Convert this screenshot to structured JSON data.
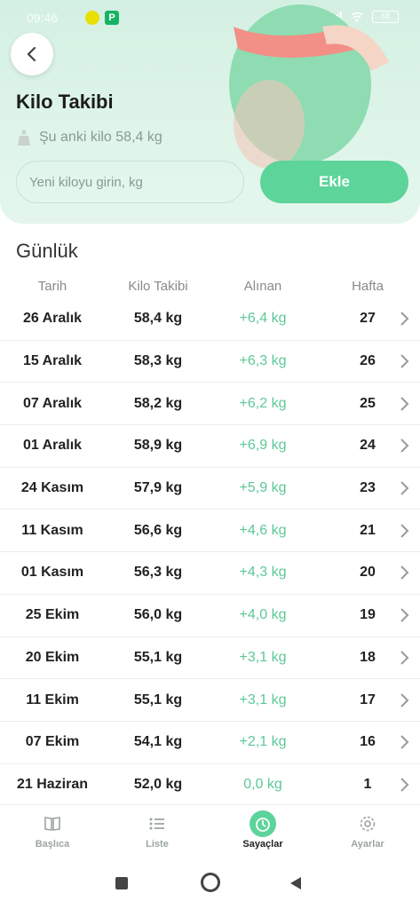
{
  "statusbar": {
    "time": "09:46",
    "battery": "68"
  },
  "header": {
    "title": "Kilo Takibi",
    "current_weight": "Şu anki kilo 58,4 kg",
    "input_placeholder": "Yeni kiloyu girin, kg",
    "add_label": "Ekle"
  },
  "section": {
    "title": "Günlük",
    "columns": [
      "Tarih",
      "Kilo Takibi",
      "Alınan",
      "Hafta"
    ]
  },
  "rows": [
    {
      "date": "26 Aralık",
      "kg": "58,4 kg",
      "gain": "+6,4 kg",
      "week": "27"
    },
    {
      "date": "15 Aralık",
      "kg": "58,3 kg",
      "gain": "+6,3 kg",
      "week": "26"
    },
    {
      "date": "07 Aralık",
      "kg": "58,2 kg",
      "gain": "+6,2 kg",
      "week": "25"
    },
    {
      "date": "01 Aralık",
      "kg": "58,9 kg",
      "gain": "+6,9 kg",
      "week": "24"
    },
    {
      "date": "24 Kasım",
      "kg": "57,9 kg",
      "gain": "+5,9 kg",
      "week": "23"
    },
    {
      "date": "11 Kasım",
      "kg": "56,6 kg",
      "gain": "+4,6 kg",
      "week": "21"
    },
    {
      "date": "01 Kasım",
      "kg": "56,3 kg",
      "gain": "+4,3 kg",
      "week": "20"
    },
    {
      "date": "25 Ekim",
      "kg": "56,0 kg",
      "gain": "+4,0 kg",
      "week": "19"
    },
    {
      "date": "20 Ekim",
      "kg": "55,1 kg",
      "gain": "+3,1 kg",
      "week": "18"
    },
    {
      "date": "11 Ekim",
      "kg": "55,1 kg",
      "gain": "+3,1 kg",
      "week": "17"
    },
    {
      "date": "07 Ekim",
      "kg": "54,1 kg",
      "gain": "+2,1 kg",
      "week": "16"
    },
    {
      "date": "21 Haziran",
      "kg": "52,0 kg",
      "gain": "0,0 kg",
      "week": "1"
    }
  ],
  "nav": [
    {
      "label": "Başlıca",
      "icon": "book-icon"
    },
    {
      "label": "Liste",
      "icon": "list-icon"
    },
    {
      "label": "Sayaçlar",
      "icon": "timer-icon",
      "active": true
    },
    {
      "label": "Ayarlar",
      "icon": "gear-icon"
    }
  ],
  "colors": {
    "accent": "#5cd49a",
    "header_bg": "#d9f3e6",
    "gain_text": "#5cc896"
  }
}
